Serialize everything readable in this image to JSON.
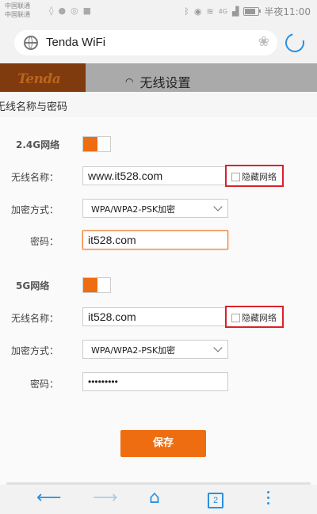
{
  "status_bar": {
    "carrier1": "中国联通",
    "carrier2": "中国联通",
    "net_label": "4G",
    "battery_level": 0.7,
    "time": "半夜11:00"
  },
  "browser": {
    "url": "Tenda WiFi",
    "tabs_count": "2"
  },
  "header": {
    "logo": "Tenda",
    "title": "无线设置"
  },
  "modal": {
    "title": "无线名称与密码",
    "bands": [
      {
        "label": "2.4G网络",
        "enabled": true,
        "ssid_label": "无线名称：",
        "ssid": "www.it528.com",
        "hide_label": "隐藏网络",
        "security_label": "加密方式：",
        "security": "WPA/WPA2-PSK加密",
        "password_label": "密码：",
        "password": "it528.com"
      },
      {
        "label": "5G网络",
        "enabled": true,
        "ssid_label": "无线名称：",
        "ssid": "it528.com",
        "hide_label": "隐藏网络",
        "security_label": "加密方式：",
        "security": "WPA/WPA2-PSK加密",
        "password_label": "密码：",
        "password": "•••••••••"
      }
    ],
    "save_label": "保存"
  },
  "colors": {
    "accent": "#ee6d11",
    "highlight_box": "#d9222b",
    "browser_blue": "#2a90e0"
  },
  "icons": {
    "back": "arrow-left-icon",
    "forward": "arrow-right-icon",
    "home": "home-icon",
    "tabs": "tabs-icon",
    "menu": "more-vertical-icon"
  }
}
